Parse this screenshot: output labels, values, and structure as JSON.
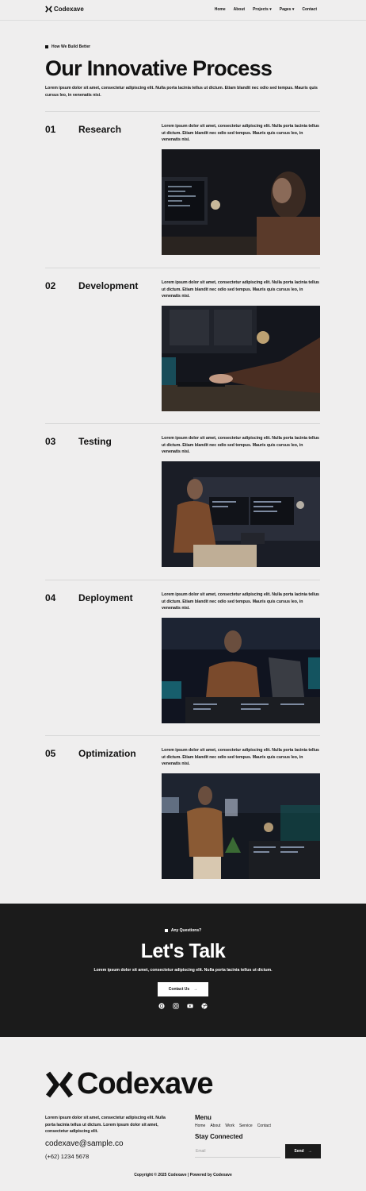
{
  "header": {
    "brand": "Codexave",
    "nav": [
      {
        "label": "Home",
        "dropdown": false
      },
      {
        "label": "About",
        "dropdown": false
      },
      {
        "label": "Projects",
        "dropdown": true
      },
      {
        "label": "Pages",
        "dropdown": true
      },
      {
        "label": "Contact",
        "dropdown": false
      }
    ]
  },
  "hero": {
    "eyebrow": "How We Build Better",
    "title": "Our Innovative Process",
    "text": "Lorem ipsum dolor sit amet, consectetur adipiscing elit. Nulla porta lacinia tellus ut dictum. Etiam blandit nec odio sed tempus. Mauris quis cursus leo, in venenatis nisi."
  },
  "steps": [
    {
      "number": "01",
      "name": "Research",
      "text": "Lorem ipsum dolor sit amet, consectetur adipiscing elit. Nulla porta lacinia tellus ut dictum. Etiam blandit nec odio sed tempus. Mauris quis cursus leo, in venenatis nisi."
    },
    {
      "number": "02",
      "name": "Development",
      "text": "Lorem ipsum dolor sit amet, consectetur adipiscing elit. Nulla porta lacinia tellus ut dictum. Etiam blandit nec odio sed tempus. Mauris quis cursus leo, in venenatis nisi."
    },
    {
      "number": "03",
      "name": "Testing",
      "text": "Lorem ipsum dolor sit amet, consectetur adipiscing elit. Nulla porta lacinia tellus ut dictum. Etiam blandit nec odio sed tempus. Mauris quis cursus leo, in venenatis nisi."
    },
    {
      "number": "04",
      "name": "Deployment",
      "text": "Lorem ipsum dolor sit amet, consectetur adipiscing elit. Nulla porta lacinia tellus ut dictum. Etiam blandit nec odio sed tempus. Mauris quis cursus leo, in venenatis nisi."
    },
    {
      "number": "05",
      "name": "Optimization",
      "text": "Lorem ipsum dolor sit amet, consectetur adipiscing elit. Nulla porta lacinia tellus ut dictum. Etiam blandit nec odio sed tempus. Mauris quis cursus leo, in venenatis nisi."
    }
  ],
  "cta": {
    "eyebrow": "Any Questions?",
    "title": "Let's Talk",
    "text": "Lorem ipsum dolor sit amet, consectetur adipiscing elit. Nulla porta lacinia tellus ut dictum.",
    "button": "Contact Us",
    "socials": [
      "instagram-alt-icon",
      "instagram-icon",
      "youtube-icon",
      "dribbble-icon"
    ]
  },
  "footer": {
    "brand": "Codexave",
    "text": "Lorem ipsum dolor sit amet, consectetur adipiscing elit. Nulla porta lacinia tellus ut dictum. Lorem ipsum dolor sit amet, consectetur adipiscing elit.",
    "email": "codexave@sample.co",
    "phone": "(+62) 1234 5678",
    "menu_title": "Menu",
    "menu": [
      "Home",
      "About",
      "Work",
      "Service",
      "Contact"
    ],
    "stay_title": "Stay Connected",
    "email_placeholder": "Email",
    "send": "Send",
    "copyright": "Copyright © 2025 Codexave | Powered by Codexave"
  },
  "colors": {
    "background": "#efeeee",
    "dark": "#1b1b1b",
    "text": "#111111"
  }
}
